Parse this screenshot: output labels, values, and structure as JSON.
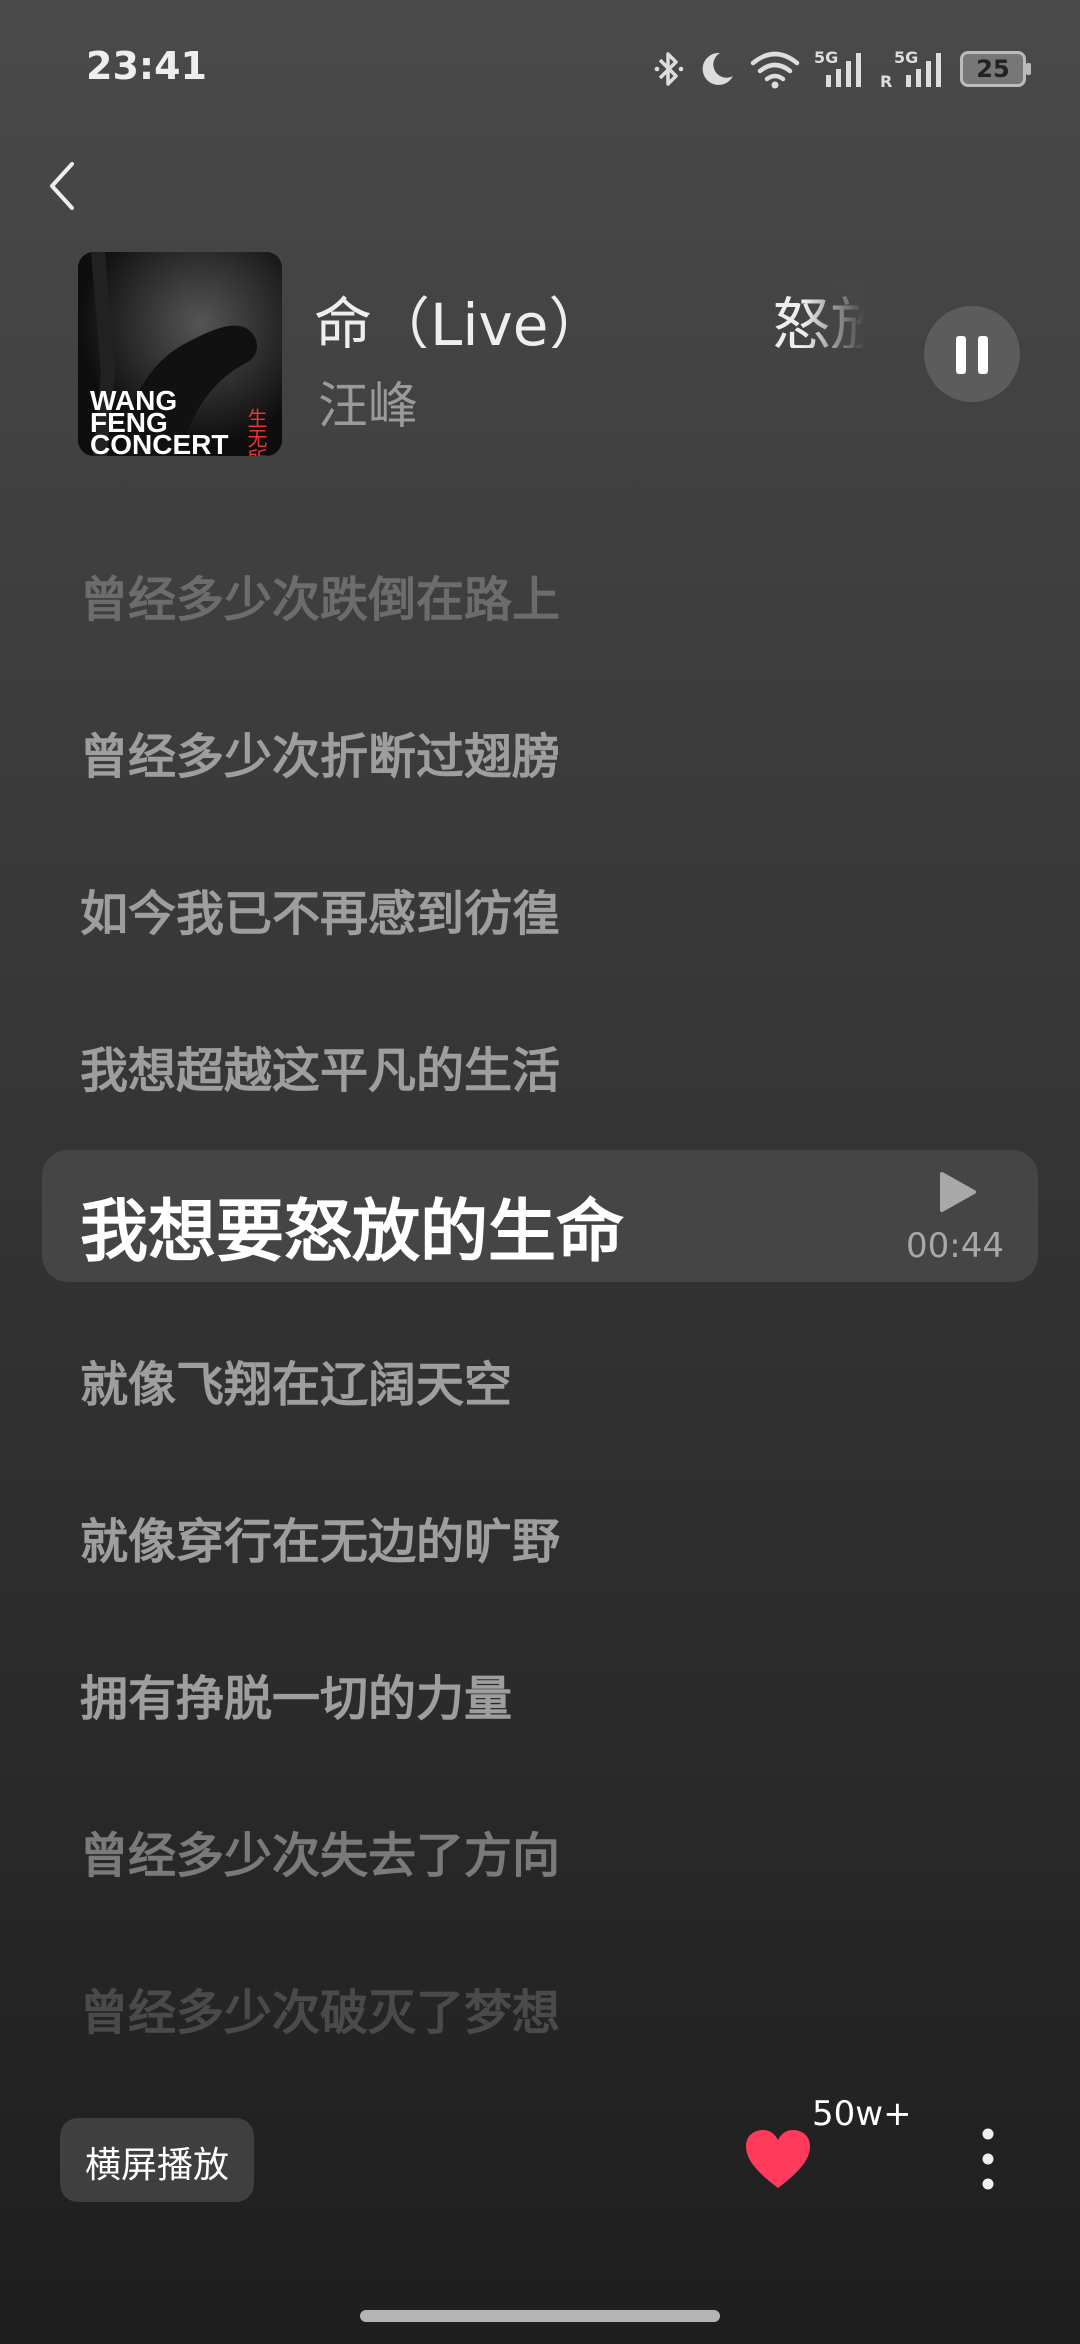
{
  "status_bar": {
    "time": "23:41",
    "battery": "25",
    "network_1": "5G",
    "network_2": "5G",
    "roaming": "R"
  },
  "now_playing": {
    "title": "命（Live）         怒放的",
    "artist": "汪峰",
    "cover_text": [
      "WANG",
      "FENG",
      "CONCERT"
    ],
    "cover_side_text": "生无所"
  },
  "lyrics": {
    "before": [
      "曾经多少次跌倒在路上",
      "曾经多少次折断过翅膀",
      "如今我已不再感到彷徨",
      "我想超越这平凡的生活"
    ],
    "current": "我想要怒放的生命",
    "current_time": "00:44",
    "after": [
      "就像飞翔在辽阔天空",
      "就像穿行在无边的旷野",
      "拥有挣脱一切的力量",
      "曾经多少次失去了方向",
      "曾经多少次破灭了梦想"
    ]
  },
  "bottom_bar": {
    "landscape_label": "横屏播放",
    "like_count": "50w+"
  },
  "colors": {
    "heart": "#ff3b5c",
    "active_row_bg": "#454545"
  }
}
